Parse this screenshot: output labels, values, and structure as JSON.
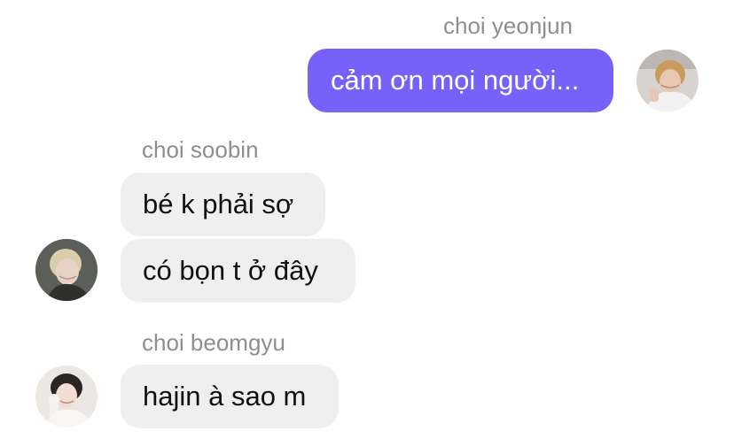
{
  "chat": {
    "outgoing": {
      "sender": "choi yeonjun",
      "message": "cảm ơn mọi người..."
    },
    "soobin": {
      "sender": "choi soobin",
      "messages": [
        "bé k phải sợ",
        "có bọn t ở đây"
      ]
    },
    "beomgyu": {
      "sender": "choi beomgyu",
      "messages": [
        "hajin à sao m"
      ]
    }
  },
  "avatars": {
    "yeonjun": "profile-photo",
    "soobin": "profile-photo",
    "beomgyu": "profile-photo"
  },
  "colors": {
    "outgoing_bubble": "#7761fb",
    "incoming_bubble": "#efeff0",
    "sender_name": "#8e8e93"
  }
}
